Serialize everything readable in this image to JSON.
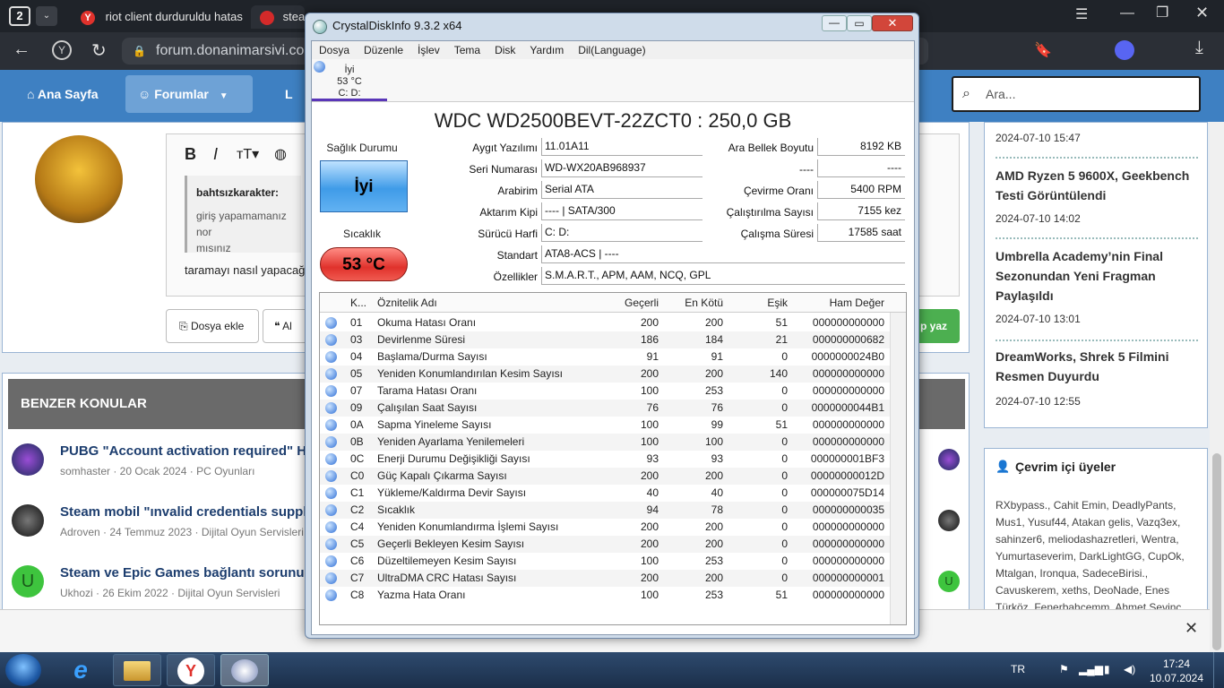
{
  "browser": {
    "tab_count": "2",
    "tabs": [
      {
        "label": "riot client durduruldu hatası"
      },
      {
        "label": "steam"
      }
    ],
    "url": "forum.donanimarsivi.com"
  },
  "forum": {
    "nav": {
      "home": "Ana Sayfa",
      "forums": "Forumlar",
      "more": "L"
    },
    "search_placeholder": "Ara...",
    "quote_author": "bahtsızkarakter:",
    "quote_text_1": "giriş yapamamanız nor",
    "quote_text_2": "mısınız",
    "reply_text": "taramayı nasıl yapacağ",
    "attach_button": "Dosya ekle",
    "quote_button": "Al",
    "post_button": "p yaz",
    "similar_title": "BENZER KONULAR",
    "threads": [
      {
        "title": "PUBG \"Account activation required\" Ha",
        "meta": "somhaster · 20 Ocak 2024 · PC Oyunları"
      },
      {
        "title": "Steam mobil \"ınvalid credentials suppli",
        "meta": "Adroven · 24 Temmuz 2023 · Dijital Oyun Servisleri"
      },
      {
        "title": "Steam ve Epic Games bağlantı sorunu",
        "meta": "Ukhozi · 26 Ekim 2022 · Dijital Oyun Servisleri"
      }
    ],
    "news": [
      {
        "date": "2024-07-10 15:47"
      },
      {
        "title": "AMD Ryzen 5 9600X, Geekbench Testi Görüntülendi",
        "date": "2024-07-10 14:02"
      },
      {
        "title": "Umbrella Academy’nin Final Sezonundan Yeni Fragman Paylaşıldı",
        "date": "2024-07-10 13:01"
      },
      {
        "title": "DreamWorks, Shrek 5 Filmini Resmen Duyurdu",
        "date": "2024-07-10 12:55"
      }
    ],
    "online_title": "Çevrim içi üyeler",
    "online_users": "RXbypass., Cahit Emin, DeadlyPants, Mus1, Yusuf44, Atakan gelis, Vazq3ex, sahinzer6, meliodashazretleri, Wentra, Yumurtaseverim, DarkLightGG, CupOk, Mtalgan, Ironqua, SadeceBirisi., Cavuskerem, xeths, DeoNade, Enes Türköz, Fenerbahcemm, Ahmet Sevinç"
  },
  "cdi": {
    "title": "CrystalDiskInfo 9.3.2 x64",
    "menu": [
      "Dosya",
      "Düzenle",
      "İşlev",
      "Tema",
      "Disk",
      "Yardım",
      "Dil(Language)"
    ],
    "disk_tab": {
      "status": "İyi",
      "temp": "53 °C",
      "drives": "C: D:"
    },
    "model": "WDC WD2500BEVT-22ZCT0 : 250,0 GB",
    "health_label": "Sağlık Durumu",
    "health_value": "İyi",
    "temp_label": "Sıcaklık",
    "temp_value": "53 °C",
    "fields_left": [
      {
        "label": "Aygıt Yazılımı",
        "value": "11.01A11"
      },
      {
        "label": "Seri Numarası",
        "value": "WD-WX20AB968937"
      },
      {
        "label": "Arabirim",
        "value": "Serial ATA"
      },
      {
        "label": "Aktarım Kipi",
        "value": "---- | SATA/300"
      },
      {
        "label": "Sürücü Harfi",
        "value": "C: D:"
      }
    ],
    "fields_right": [
      {
        "label": "Ara Bellek Boyutu",
        "value": "8192 KB"
      },
      {
        "label": "----",
        "value": "----"
      },
      {
        "label": "Çevirme Oranı",
        "value": "5400 RPM"
      },
      {
        "label": "Çalıştırılma Sayısı",
        "value": "7155 kez"
      },
      {
        "label": "Çalışma Süresi",
        "value": "17585 saat"
      }
    ],
    "standard_label": "Standart",
    "standard_value": "ATA8-ACS | ----",
    "features_label": "Özellikler",
    "features_value": "S.M.A.R.T., APM, AAM, NCQ, GPL",
    "smart_headers": [
      "K...",
      "Öznitelik Adı",
      "Geçerli",
      "En Kötü",
      "Eşik",
      "Ham Değer"
    ],
    "smart_rows": [
      [
        "01",
        "Okuma Hatası Oranı",
        "200",
        "200",
        "51",
        "000000000000"
      ],
      [
        "03",
        "Devirlenme Süresi",
        "186",
        "184",
        "21",
        "000000000682"
      ],
      [
        "04",
        "Başlama/Durma Sayısı",
        "91",
        "91",
        "0",
        "0000000024B0"
      ],
      [
        "05",
        "Yeniden Konumlandırılan Kesim Sayısı",
        "200",
        "200",
        "140",
        "000000000000"
      ],
      [
        "07",
        "Tarama Hatası Oranı",
        "100",
        "253",
        "0",
        "000000000000"
      ],
      [
        "09",
        "Çalışılan Saat Sayısı",
        "76",
        "76",
        "0",
        "0000000044B1"
      ],
      [
        "0A",
        "Sapma Yineleme Sayısı",
        "100",
        "99",
        "51",
        "000000000000"
      ],
      [
        "0B",
        "Yeniden Ayarlama Yenilemeleri",
        "100",
        "100",
        "0",
        "000000000000"
      ],
      [
        "0C",
        "Enerji Durumu Değişikliği Sayısı",
        "93",
        "93",
        "0",
        "000000001BF3"
      ],
      [
        "C0",
        "Güç Kapalı Çıkarma Sayısı",
        "200",
        "200",
        "0",
        "00000000012D"
      ],
      [
        "C1",
        "Yükleme/Kaldırma Devir Sayısı",
        "40",
        "40",
        "0",
        "000000075D14"
      ],
      [
        "C2",
        "Sıcaklık",
        "94",
        "78",
        "0",
        "000000000035"
      ],
      [
        "C4",
        "Yeniden Konumlandırma İşlemi Sayısı",
        "200",
        "200",
        "0",
        "000000000000"
      ],
      [
        "C5",
        "Geçerli Bekleyen Kesim Sayısı",
        "200",
        "200",
        "0",
        "000000000000"
      ],
      [
        "C6",
        "Düzeltilemeyen Kesim Sayısı",
        "100",
        "253",
        "0",
        "000000000000"
      ],
      [
        "C7",
        "UltraDMA CRC Hatası Sayısı",
        "200",
        "200",
        "0",
        "000000000001"
      ],
      [
        "C8",
        "Yazma Hata Oranı",
        "100",
        "253",
        "51",
        "000000000000"
      ]
    ]
  },
  "taskbar": {
    "lang": "TR",
    "time": "17:24",
    "date": "10.07.2024"
  },
  "colors": {
    "nav": "#3e80c2",
    "health": "#3f9be8",
    "temp": "#e0322c"
  }
}
